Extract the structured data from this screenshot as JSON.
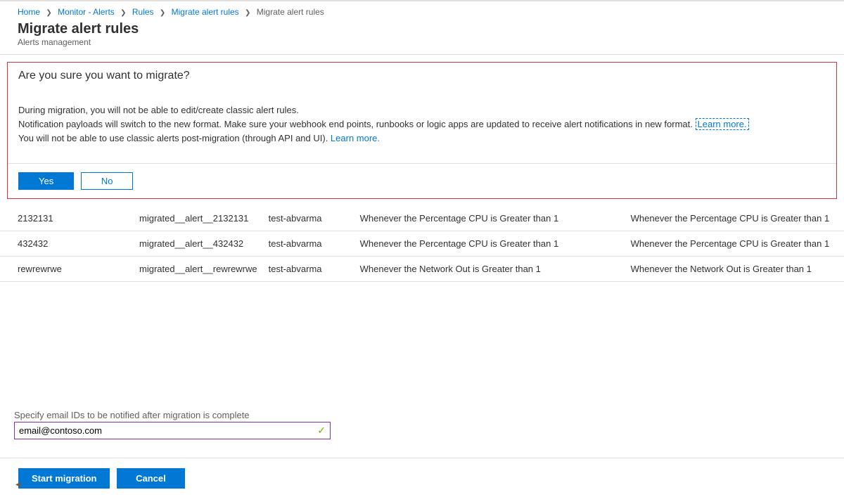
{
  "breadcrumbs": {
    "items": [
      {
        "label": "Home",
        "link": true
      },
      {
        "label": "Monitor - Alerts",
        "link": true
      },
      {
        "label": "Rules",
        "link": true
      },
      {
        "label": "Migrate alert rules",
        "link": true
      },
      {
        "label": "Migrate alert rules",
        "link": false
      }
    ]
  },
  "header": {
    "title": "Migrate alert rules",
    "subtitle": "Alerts management"
  },
  "confirm": {
    "title": "Are you sure you want to migrate?",
    "line1": "During migration, you will not be able to edit/create classic alert rules.",
    "line2_prefix": "Notification payloads will switch to the new format. Make sure your webhook end points, runbooks or logic apps are updated to receive alert notifications in new format. ",
    "line2_link": "Learn more.",
    "line3_prefix": "You will not be able to use classic alerts post-migration (through API and UI). ",
    "line3_link": "Learn more.",
    "yes": "Yes",
    "no": "No"
  },
  "rules": [
    {
      "id": "2132131",
      "name": "migrated__alert__2132131",
      "resource": "test-abvarma",
      "condition": "Whenever the Percentage CPU is Greater than 1",
      "condition2": "Whenever the Percentage CPU is Greater than 1"
    },
    {
      "id": "432432",
      "name": "migrated__alert__432432",
      "resource": "test-abvarma",
      "condition": "Whenever the Percentage CPU is Greater than 1",
      "condition2": "Whenever the Percentage CPU is Greater than 1"
    },
    {
      "id": "rewrewrwe",
      "name": "migrated__alert__rewrewrwe",
      "resource": "test-abvarma",
      "condition": "Whenever the Network Out is Greater than 1",
      "condition2": "Whenever the Network Out is Greater than 1"
    }
  ],
  "email": {
    "label": "Specify email IDs to be notified after migration is complete",
    "value": "email@contoso.com"
  },
  "footer": {
    "start": "Start migration",
    "cancel": "Cancel"
  }
}
